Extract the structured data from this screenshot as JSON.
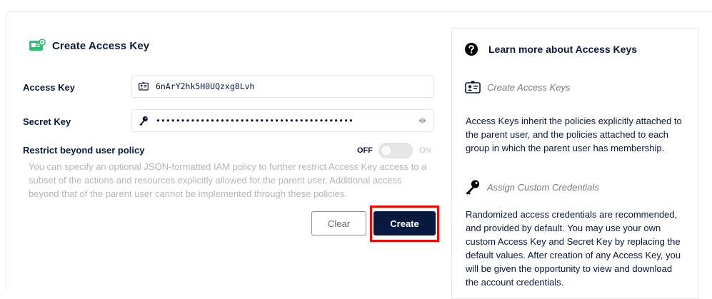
{
  "form": {
    "title": "Create Access Key",
    "access_key": {
      "label": "Access Key",
      "value": "6nArY2hk5H0UQzxg8Lvh"
    },
    "secret_key": {
      "label": "Secret Key",
      "value": "••••••••••••••••••••••••••••••••••••••••"
    },
    "restrict": {
      "label": "Restrict beyond user policy",
      "off_label": "OFF",
      "on_label": "ON",
      "enabled": false,
      "help": "You can specify an optional JSON-formatted IAM policy to further restrict Access Key access to a subset of the actions and resources explicitly allowed for the parent user. Additional access beyond that of the parent user cannot be implemented through these policies."
    },
    "buttons": {
      "clear": "Clear",
      "create": "Create"
    }
  },
  "help_panel": {
    "title": "Learn more about Access Keys",
    "section1": {
      "heading": "Create Access Keys",
      "icon": "id-card-icon",
      "text": "Access Keys inherit the policies explicitly attached to the parent user, and the policies attached to each group in which the parent user has membership."
    },
    "section2": {
      "heading": "Assign Custom Credentials",
      "icon": "key-icon",
      "text": "Randomized access credentials are recommended, and provided by default. You may use your own custom Access Key and Secret Key by replacing the default values. After creation of any Access Key, you will be given the opportunity to view and download the account credentials."
    }
  },
  "colors": {
    "primary": "#07193e",
    "accent": "#15a34a",
    "highlight": "#ff0000",
    "muted": "#b5b5b5"
  }
}
